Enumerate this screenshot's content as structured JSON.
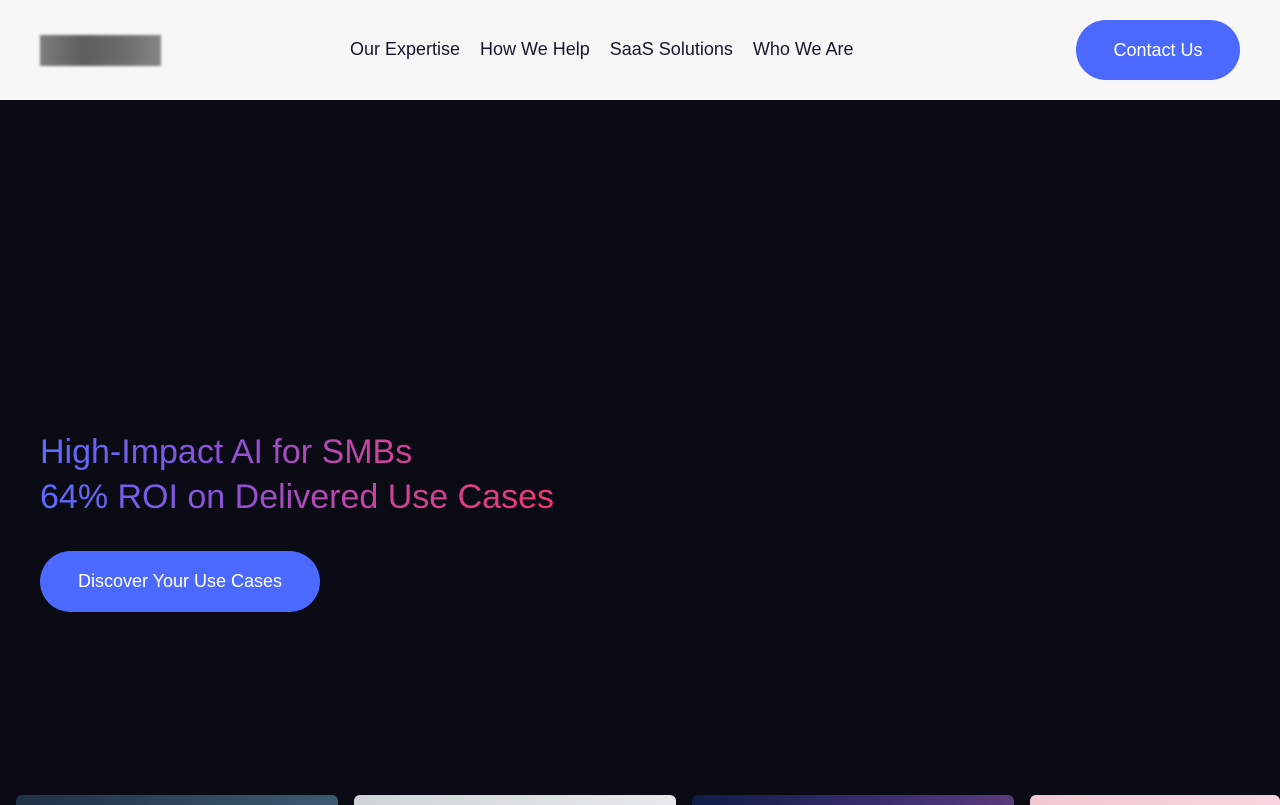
{
  "header": {
    "logo_alt": "",
    "nav": [
      {
        "label": "Our Expertise"
      },
      {
        "label": "How We Help"
      },
      {
        "label": "SaaS Solutions"
      },
      {
        "label": "Who We Are"
      }
    ],
    "contact_label": "Contact Us"
  },
  "hero": {
    "title_line1": "High-Impact AI for SMBs",
    "title_line2": "64% ROI on Delivered Use Cases",
    "cta_label": "Discover Your Use Cases"
  },
  "colors": {
    "accent": "#4b68ff",
    "header_bg": "#f7f7f7",
    "hero_bg": "#0b0b16",
    "gradient_start": "#5a6cff",
    "gradient_end": "#f0386e"
  }
}
